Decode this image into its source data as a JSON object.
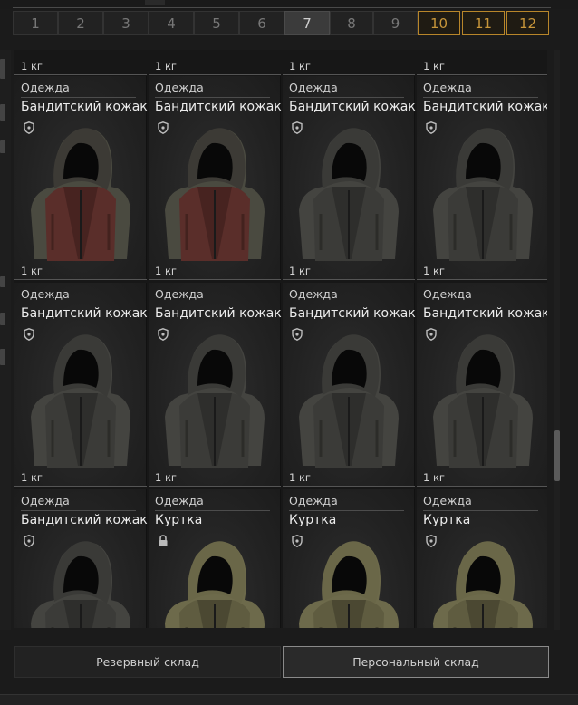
{
  "pagination": {
    "pages": [
      {
        "label": "1",
        "state": "normal"
      },
      {
        "label": "2",
        "state": "normal"
      },
      {
        "label": "3",
        "state": "normal"
      },
      {
        "label": "4",
        "state": "normal"
      },
      {
        "label": "5",
        "state": "normal"
      },
      {
        "label": "6",
        "state": "normal"
      },
      {
        "label": "7",
        "state": "active"
      },
      {
        "label": "8",
        "state": "normal"
      },
      {
        "label": "9",
        "state": "normal"
      },
      {
        "label": "10",
        "state": "premium"
      },
      {
        "label": "11",
        "state": "premium"
      },
      {
        "label": "12",
        "state": "premium"
      }
    ]
  },
  "top_weights": [
    "1 кг",
    "1 кг",
    "1 кг",
    "1 кг"
  ],
  "items": [
    {
      "category": "Одежда",
      "name": "Бандитский кожак",
      "weight": "1 кг",
      "badge": "shield",
      "color": "leather"
    },
    {
      "category": "Одежда",
      "name": "Бандитский кожак",
      "weight": "1 кг",
      "badge": "shield",
      "color": "leather"
    },
    {
      "category": "Одежда",
      "name": "Бандитский кожак",
      "weight": "1 кг",
      "badge": "shield",
      "color": "dark"
    },
    {
      "category": "Одежда",
      "name": "Бандитский кожак",
      "weight": "1 кг",
      "badge": "shield",
      "color": "dark"
    },
    {
      "category": "Одежда",
      "name": "Бандитский кожак",
      "weight": "1 кг",
      "badge": "shield",
      "color": "dark"
    },
    {
      "category": "Одежда",
      "name": "Бандитский кожак",
      "weight": "1 кг",
      "badge": "shield",
      "color": "dark"
    },
    {
      "category": "Одежда",
      "name": "Бандитский кожак",
      "weight": "1 кг",
      "badge": "shield",
      "color": "dark"
    },
    {
      "category": "Одежда",
      "name": "Бандитский кожак",
      "weight": "1 кг",
      "badge": "shield",
      "color": "dark"
    },
    {
      "category": "Одежда",
      "name": "Бандитский кожак",
      "weight": "",
      "badge": "shield",
      "color": "dark"
    },
    {
      "category": "Одежда",
      "name": "Куртка",
      "weight": "",
      "badge": "lock",
      "color": "olive"
    },
    {
      "category": "Одежда",
      "name": "Куртка",
      "weight": "",
      "badge": "shield",
      "color": "olive"
    },
    {
      "category": "Одежда",
      "name": "Куртка",
      "weight": "",
      "badge": "shield",
      "color": "olive"
    }
  ],
  "colors": {
    "leather": {
      "hood": "#3c3a35",
      "body": "#5a2e2a",
      "shade": "#3a1d1a",
      "sleeve": "#4a4a40"
    },
    "dark": {
      "hood": "#3a3a37",
      "body": "#3b3b38",
      "shade": "#262624",
      "sleeve": "#444440"
    },
    "olive": {
      "hood": "#6a6748",
      "body": "#5f5c40",
      "shade": "#3d3b29",
      "sleeve": "#6d6a4b"
    },
    "premium_border": "#b8862a"
  },
  "tabs": {
    "reserve": "Резервный склад",
    "personal": "Персональный склад"
  }
}
